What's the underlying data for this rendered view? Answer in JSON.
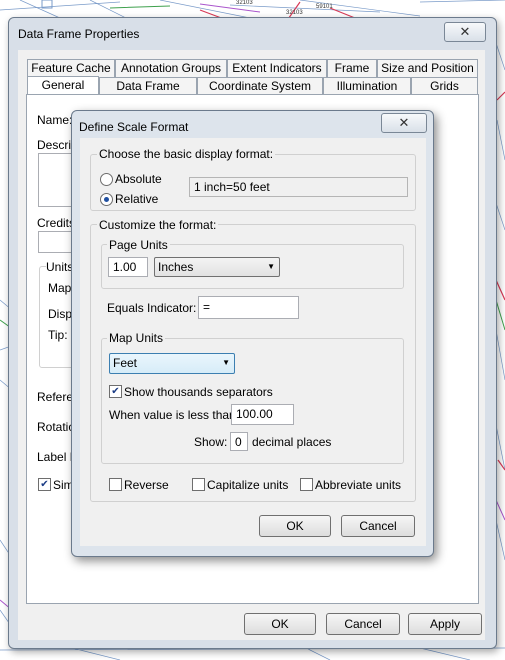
{
  "map": {
    "labels": [
      "32103",
      "59101",
      "32103"
    ]
  },
  "outer_dialog": {
    "title": "Data Frame Properties",
    "tabs_row1": [
      "Feature Cache",
      "Annotation Groups",
      "Extent Indicators",
      "Frame",
      "Size and Position"
    ],
    "tabs_row2": [
      "General",
      "Data Frame",
      "Coordinate System",
      "Illumination",
      "Grids"
    ],
    "left_labels": {
      "name": "Name:",
      "description": "Descrip",
      "credits": "Credits",
      "units": "Units",
      "map": "Map:",
      "display": "Displ",
      "tip": "Tip:",
      "reference": "Refere",
      "rotation": "Rotatio",
      "label_engine": "Label E",
      "simulate": "Sim"
    },
    "buttons": {
      "ok": "OK",
      "cancel": "Cancel",
      "apply": "Apply"
    }
  },
  "inner_dialog": {
    "title": "Define Scale Format",
    "basic_group_label": "Choose the basic display format:",
    "absolute_label": "Absolute",
    "relative_label": "Relative",
    "selected_format": "relative",
    "preview_text": "1 inch=50 feet",
    "customize_label": "Customize the format:",
    "page_units_label": "Page Units",
    "page_units_value": "1.00",
    "page_units_select": "Inches",
    "equals_label": "Equals Indicator:",
    "equals_value": "=",
    "map_units_label": "Map Units",
    "map_units_select": "Feet",
    "show_thousands_label": "Show thousands separators",
    "show_thousands_checked": true,
    "when_less_label": "When value is less than:",
    "when_less_value": "100.00",
    "show_label": "Show:",
    "decimal_value": "0",
    "decimal_places_label": "decimal places",
    "reverse_label": "Reverse",
    "capitalize_label": "Capitalize units",
    "abbreviate_label": "Abbreviate units",
    "ok_label": "OK",
    "cancel_label": "Cancel"
  },
  "icons": {
    "close": "close-icon",
    "dropdown": "chevron-down-icon",
    "check": "check-icon"
  }
}
